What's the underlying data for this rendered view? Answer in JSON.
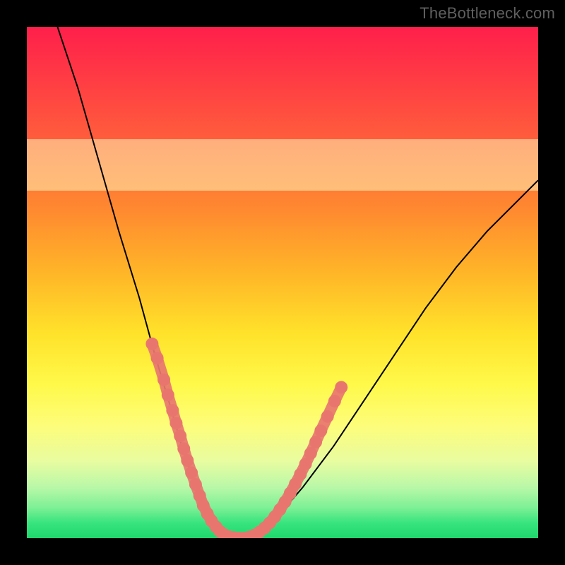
{
  "watermark": "TheBottleneck.com",
  "chart_data": {
    "type": "line",
    "title": "",
    "xlabel": "",
    "ylabel": "",
    "xlim": [
      0,
      100
    ],
    "ylim": [
      0,
      100
    ],
    "series": [
      {
        "name": "bottleneck-curve",
        "color": "#000000",
        "x": [
          6,
          10,
          14,
          18,
          22,
          25,
          28,
          30,
          32,
          34,
          36,
          39,
          42,
          48,
          54,
          60,
          66,
          72,
          78,
          84,
          90,
          96,
          100
        ],
        "values": [
          100,
          88,
          74,
          60,
          47,
          36,
          26,
          19,
          13,
          8,
          4,
          1,
          0,
          3,
          10,
          18,
          27,
          36,
          45,
          53,
          60,
          66,
          70
        ]
      }
    ],
    "marker_clusters": [
      {
        "name": "left-cluster",
        "color": "#e8766f",
        "x": [
          24.5,
          25.5,
          26.8,
          27.6,
          28.5,
          29.2,
          30.0,
          30.7,
          31.4,
          32.2,
          33.0,
          33.8,
          34.5,
          35.3,
          36.1,
          37.0,
          37.8,
          38.6
        ],
        "values": [
          38.0,
          35.2,
          31.0,
          28.0,
          25.0,
          22.5,
          20.0,
          17.5,
          15.2,
          12.8,
          10.5,
          8.3,
          6.4,
          4.8,
          3.4,
          2.2,
          1.3,
          0.7
        ]
      },
      {
        "name": "valley-flat",
        "color": "#e8766f",
        "x": [
          39.5,
          40.5,
          41.5,
          42.5,
          43.5,
          44.5,
          45.5
        ],
        "values": [
          0.3,
          0.1,
          0.0,
          0.0,
          0.2,
          0.6,
          1.2
        ]
      },
      {
        "name": "right-cluster",
        "color": "#e8766f",
        "x": [
          46.5,
          47.5,
          48.5,
          49.5,
          50.5,
          51.5,
          52.5,
          53.5,
          54.5,
          55.5,
          56.5,
          57.5,
          58.8,
          60.2,
          61.5
        ],
        "values": [
          2.0,
          3.0,
          4.2,
          5.6,
          7.1,
          8.8,
          10.6,
          12.5,
          14.5,
          16.6,
          18.8,
          21.0,
          23.8,
          26.8,
          29.5
        ]
      }
    ],
    "highlight_band": {
      "y_from": 68,
      "y_to": 78
    }
  }
}
